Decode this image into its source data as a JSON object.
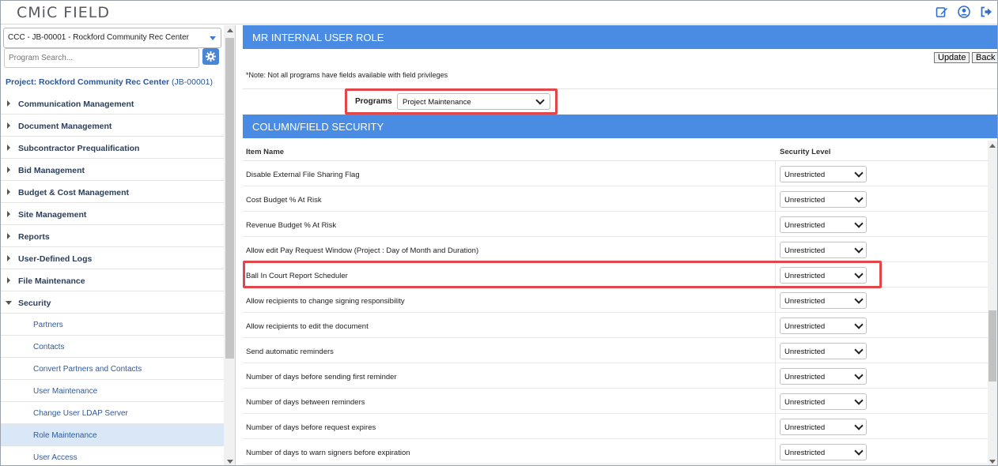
{
  "app": {
    "title": "CMiC FIELD"
  },
  "topbar": {
    "icons": [
      "edit-icon",
      "user-icon",
      "logout-icon"
    ]
  },
  "sidebar": {
    "project_select": "CCC - JB-00001 - Rockford Community Rec Center",
    "search_placeholder": "Program Search...",
    "project_title": "Project: Rockford Community Rec Center",
    "project_code": "(JB-00001)",
    "items": [
      {
        "label": "Communication Management"
      },
      {
        "label": "Document Management"
      },
      {
        "label": "Subcontractor Prequalification"
      },
      {
        "label": "Bid Management"
      },
      {
        "label": "Budget & Cost Management"
      },
      {
        "label": "Site Management"
      },
      {
        "label": "Reports"
      },
      {
        "label": "User-Defined Logs"
      },
      {
        "label": "File Maintenance"
      },
      {
        "label": "Security"
      }
    ],
    "subitems": [
      {
        "label": "Partners"
      },
      {
        "label": "Contacts"
      },
      {
        "label": "Convert Partners and Contacts"
      },
      {
        "label": "User Maintenance"
      },
      {
        "label": "Change User LDAP Server"
      },
      {
        "label": "Role Maintenance"
      },
      {
        "label": "User Access"
      }
    ]
  },
  "main": {
    "role_header": "MR INTERNAL USER ROLE",
    "update_label": "Update",
    "back_label": "Back",
    "note": "*Note: Not all programs have fields available with field privileges",
    "programs_label": "Programs",
    "programs_value": "Project Maintenance",
    "section_header": "COLUMN/FIELD SECURITY",
    "col_item": "Item Name",
    "col_level": "Security Level",
    "rows": [
      {
        "name": "Disable External File Sharing Flag",
        "level": "Unrestricted"
      },
      {
        "name": "Cost Budget % At Risk",
        "level": "Unrestricted"
      },
      {
        "name": "Revenue Budget % At Risk",
        "level": "Unrestricted"
      },
      {
        "name": "Allow edit Pay Request Window (Project : Day of Month and Duration)",
        "level": "Unrestricted"
      },
      {
        "name": "Ball In Court Report Scheduler",
        "level": "Unrestricted"
      },
      {
        "name": "Allow recipients to change signing responsibility",
        "level": "Unrestricted"
      },
      {
        "name": "Allow recipients to edit the document",
        "level": "Unrestricted"
      },
      {
        "name": "Send automatic reminders",
        "level": "Unrestricted"
      },
      {
        "name": "Number of days before sending first reminder",
        "level": "Unrestricted"
      },
      {
        "name": "Number of days between reminders",
        "level": "Unrestricted"
      },
      {
        "name": "Number of days before request expires",
        "level": "Unrestricted"
      },
      {
        "name": "Number of days to warn signers before expiration",
        "level": "Unrestricted"
      }
    ]
  },
  "colors": {
    "accent": "#4a8ce4",
    "highlight": "#e0464a",
    "selected": "#dae7f6"
  }
}
